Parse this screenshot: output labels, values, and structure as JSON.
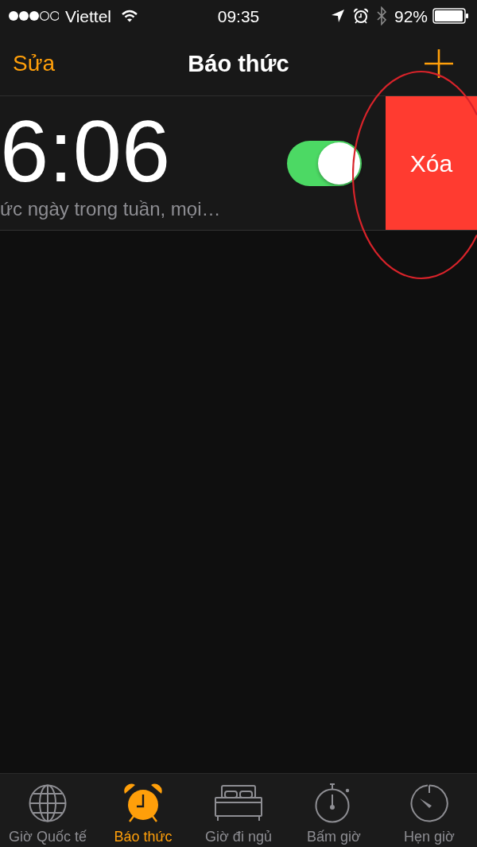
{
  "status_bar": {
    "carrier": "Viettel",
    "time": "09:35",
    "battery": "92%"
  },
  "nav_bar": {
    "edit_button": "Sửa",
    "title": "Báo thức"
  },
  "alarms": [
    {
      "time": "6:06",
      "label": "ức ngày trong tuần, mọi…",
      "on": true,
      "delete_button": "Xóa"
    }
  ],
  "tabs": [
    {
      "label": "Giờ Quốc tế",
      "selected": false
    },
    {
      "label": "Báo thức",
      "selected": true
    },
    {
      "label": "Giờ đi ngủ",
      "selected": false
    },
    {
      "label": "Bấm giờ",
      "selected": false
    },
    {
      "label": "Hẹn giờ",
      "selected": false
    }
  ]
}
